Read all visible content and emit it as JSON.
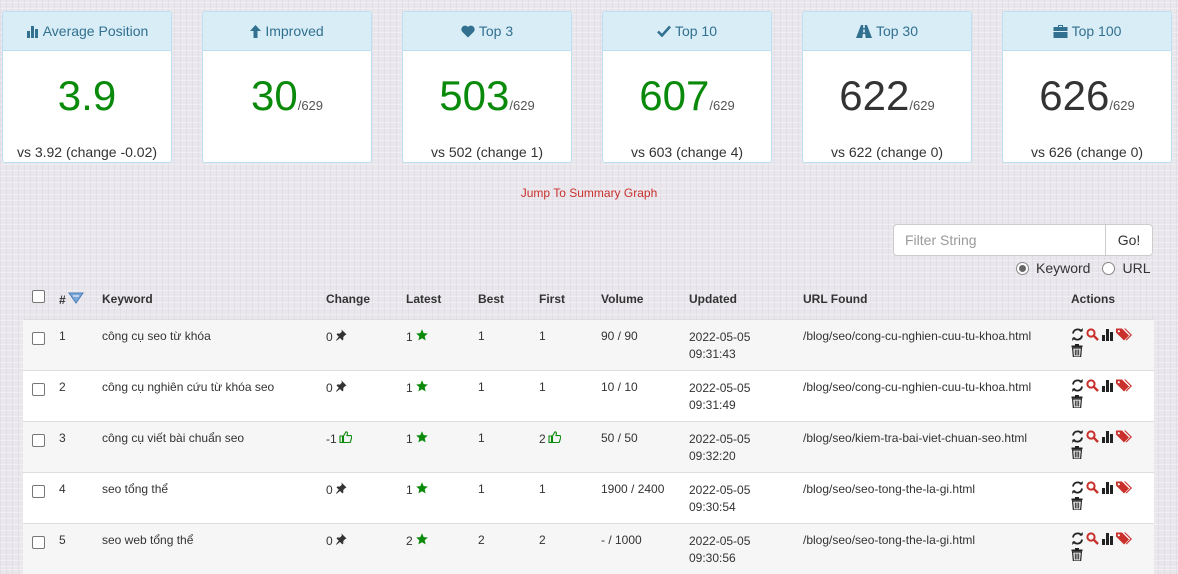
{
  "cards": [
    {
      "title": "Average Position",
      "icon": "bar-chart-icon",
      "value": "3.9",
      "total": "",
      "footer": "vs 3.92 (change -0.02)",
      "color": "#0a8a0a"
    },
    {
      "title": "Improved",
      "icon": "arrow-up-icon",
      "value": "30",
      "total": "/629",
      "footer": "",
      "color": "#0a8a0a"
    },
    {
      "title": "Top 3",
      "icon": "heart-icon",
      "value": "503",
      "total": "/629",
      "footer": "vs 502 (change 1)",
      "color": "#0a8a0a"
    },
    {
      "title": "Top 10",
      "icon": "check-icon",
      "value": "607",
      "total": "/629",
      "footer": "vs 603 (change 4)",
      "color": "#0a8a0a"
    },
    {
      "title": "Top 30",
      "icon": "road-icon",
      "value": "622",
      "total": "/629",
      "footer": "vs 622 (change 0)",
      "color": "#333333"
    },
    {
      "title": "Top 100",
      "icon": "briefcase-icon",
      "value": "626",
      "total": "/629",
      "footer": "vs 626 (change 0)",
      "color": "#333333"
    }
  ],
  "jump_link": "Jump To Summary Graph",
  "filter": {
    "placeholder": "Filter String",
    "button": "Go!",
    "options": [
      "Keyword",
      "URL"
    ],
    "selected": "Keyword"
  },
  "table": {
    "headers": {
      "num": "#",
      "keyword": "Keyword",
      "change": "Change",
      "latest": "Latest",
      "best": "Best",
      "first": "First",
      "volume": "Volume",
      "updated": "Updated",
      "url": "URL Found",
      "actions": "Actions"
    },
    "rows": [
      {
        "num": "1",
        "keyword": "công cụ seo từ khóa",
        "change": "0",
        "latest": "1",
        "best": "1",
        "first": "1",
        "volume": "90 / 90",
        "updated": "2022-05-05 09:31:43",
        "url": "/blog/seo/cong-cu-nghien-cuu-tu-khoa.html"
      },
      {
        "num": "2",
        "keyword": "công cụ nghiên cứu từ khóa seo",
        "change": "0",
        "latest": "1",
        "best": "1",
        "first": "1",
        "volume": "10 / 10",
        "updated": "2022-05-05 09:31:49",
        "url": "/blog/seo/cong-cu-nghien-cuu-tu-khoa.html"
      },
      {
        "num": "3",
        "keyword": "công cụ viết bài chuẩn seo",
        "change": "-1",
        "latest": "1",
        "best": "1",
        "first": "2",
        "volume": "50 / 50",
        "updated": "2022-05-05 09:32:20",
        "url": "/blog/seo/kiem-tra-bai-viet-chuan-seo.html"
      },
      {
        "num": "4",
        "keyword": "seo tổng thể",
        "change": "0",
        "latest": "1",
        "best": "1",
        "first": "1",
        "volume": "1900 / 2400",
        "updated": "2022-05-05 09:30:54",
        "url": "/blog/seo/seo-tong-the-la-gi.html"
      },
      {
        "num": "5",
        "keyword": "seo web tổng thể",
        "change": "0",
        "latest": "2",
        "best": "2",
        "first": "2",
        "volume": "- / 1000",
        "updated": "2022-05-05 09:30:56",
        "url": "/blog/seo/seo-tong-the-la-gi.html"
      }
    ]
  }
}
